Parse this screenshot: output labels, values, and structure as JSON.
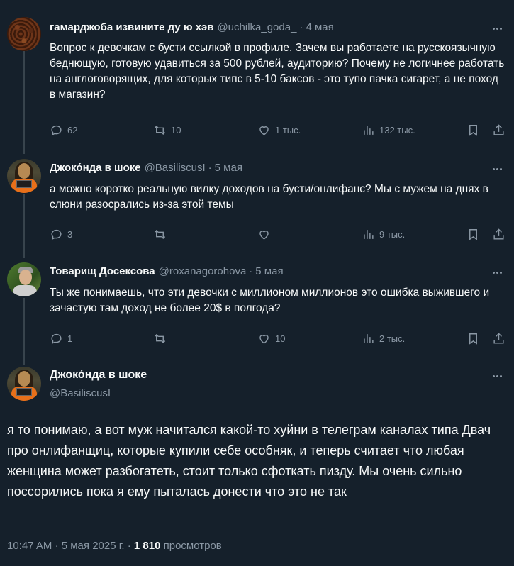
{
  "tweets": [
    {
      "name": "гамарджоба извините ду ю хэв",
      "handle": "@uchilka_goda_",
      "date": "4 мая",
      "text": "Вопрос к девочкам с бусти ссылкой в профиле. Зачем вы работаете на русскоязычную беднющую, готовую удавиться за 500 рублей, аудиторию? Почему не логичнее работать на англоговорящих, для которых типс в 5-10 баксов - это тупо пачка сигарет, а не поход в магазин?",
      "replies": "62",
      "retweets": "10",
      "likes": "1 тыс.",
      "views": "132 тыс."
    },
    {
      "name": "Джоко́нда в шоке",
      "handle": "@BasiliscusI",
      "date": "5 мая",
      "text": "а можно коротко реальную вилку доходов на бусти/онлифанс? Мы с мужем на днях в слюни разосрались из-за этой темы",
      "replies": "3",
      "retweets": "",
      "likes": "",
      "views": "9 тыс."
    },
    {
      "name": "Товарищ Досексова",
      "handle": "@roxanagorohova",
      "date": "5 мая",
      "text": "Ты же понимаешь, что эти девочки с миллионом миллионов это ошибка выжившего и зачастую там доход не более 20$ в полгода?",
      "replies": "1",
      "retweets": "",
      "likes": "10",
      "views": "2 тыс."
    }
  ],
  "main": {
    "name": "Джоко́нда в шоке",
    "handle": "@BasiliscusI",
    "text": "я то понимаю, а вот муж начитался какой-то хуйни в телеграм каналах типа Двач про онлифанщиц, которые купили себе особняк, и теперь считает что любая женщина может разбогатеть, стоит только сфоткать пизду. Мы очень сильно поссорились пока я ему пыталась донести что это не так",
    "time": "10:47 AM",
    "sep": "·",
    "date": "5 мая 2025 г.",
    "views_count": "1 810",
    "views_label": "просмотров"
  },
  "ui": {
    "dot": "·",
    "icons": [
      "reply-icon",
      "retweet-icon",
      "like-icon",
      "views-icon",
      "bookmark-icon",
      "share-icon",
      "more-icon"
    ],
    "colors": {
      "background": "#15202b",
      "text": "#f7f9f9",
      "secondary": "#8b98a5",
      "thread_line": "#38444d"
    }
  }
}
